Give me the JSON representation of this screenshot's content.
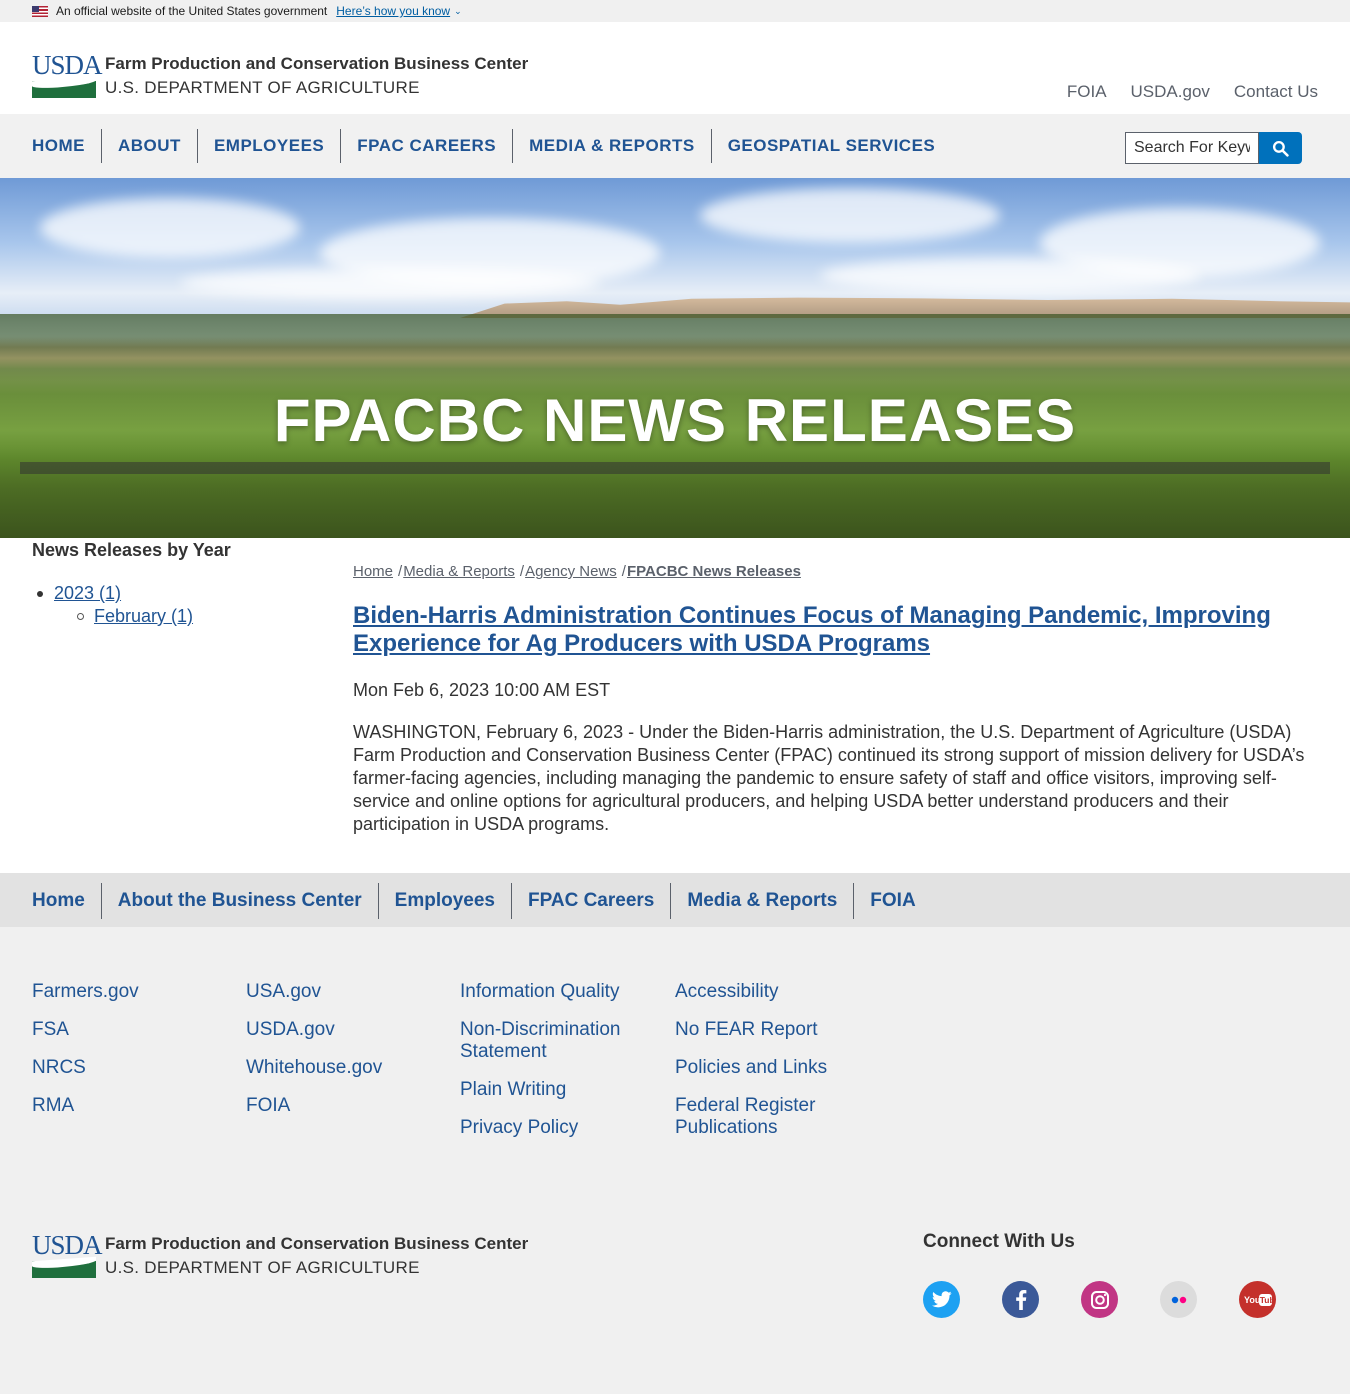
{
  "gov_banner": {
    "text": "An official website of the United States government",
    "link": "Here’s how you know"
  },
  "header": {
    "logo_text": "USDA",
    "org_name": "Farm Production and Conservation Business Center",
    "dept_name": "U.S. DEPARTMENT OF AGRICULTURE",
    "utility_links": [
      "FOIA",
      "USDA.gov",
      "Contact Us"
    ]
  },
  "main_nav": {
    "items": [
      "HOME",
      "ABOUT",
      "EMPLOYEES",
      "FPAC CAREERS",
      "MEDIA & REPORTS",
      "GEOSPATIAL SERVICES"
    ]
  },
  "search": {
    "placeholder": "Search For Keyw"
  },
  "hero": {
    "title": "FPACBC NEWS RELEASES"
  },
  "sidebar": {
    "heading": "News Releases by Year",
    "year": "2023 (1)",
    "month": "February (1)"
  },
  "breadcrumb": {
    "items": [
      "Home",
      "Media & Reports",
      "Agency News"
    ],
    "current": "FPACBC News Releases",
    "separator": "/"
  },
  "article": {
    "title": "Biden-Harris Administration Continues Focus of Managing Pandemic, Improving Experience for Ag Producers with USDA Programs",
    "date": "Mon Feb 6, 2023 10:00 AM EST",
    "body": "WASHINGTON, February 6, 2023 - Under the Biden-Harris administration, the U.S. Department of Agriculture (USDA) Farm Production and Conservation Business Center (FPAC) continued its strong support of mission delivery for USDA’s farmer-facing agencies, including managing the pandemic to ensure safety of staff and office visitors, improving self-service and online options for agricultural producers, and helping USDA better understand producers and their participation in USDA programs."
  },
  "footer_nav": {
    "items": [
      "Home",
      "About the Business Center",
      "Employees",
      "FPAC Careers",
      "Media & Reports",
      "FOIA"
    ]
  },
  "footer_links": {
    "col1": [
      "Farmers.gov",
      "FSA",
      "NRCS",
      "RMA"
    ],
    "col2": [
      "USA.gov",
      "USDA.gov",
      "Whitehouse.gov",
      "FOIA"
    ],
    "col3": [
      "Information Quality",
      "Non-Discrimination Statement",
      "Plain Writing",
      "Privacy Policy"
    ],
    "col4": [
      "Accessibility",
      "No FEAR Report",
      "Policies and Links",
      "Federal Register Publications"
    ]
  },
  "connect": {
    "heading": "Connect With Us",
    "socials": [
      {
        "icon": "twitter-icon",
        "color": "#1da1f2"
      },
      {
        "icon": "facebook-icon",
        "color": "#3b5998"
      },
      {
        "icon": "instagram-icon",
        "color": "#c13584"
      },
      {
        "icon": "flickr-icon",
        "color": "#dcdcdc"
      },
      {
        "icon": "youtube-icon",
        "color": "#c4302b"
      }
    ]
  },
  "colors": {
    "brand_blue": "#205493",
    "usda_green": "#1f6f3d",
    "search_button": "#0071bc"
  }
}
